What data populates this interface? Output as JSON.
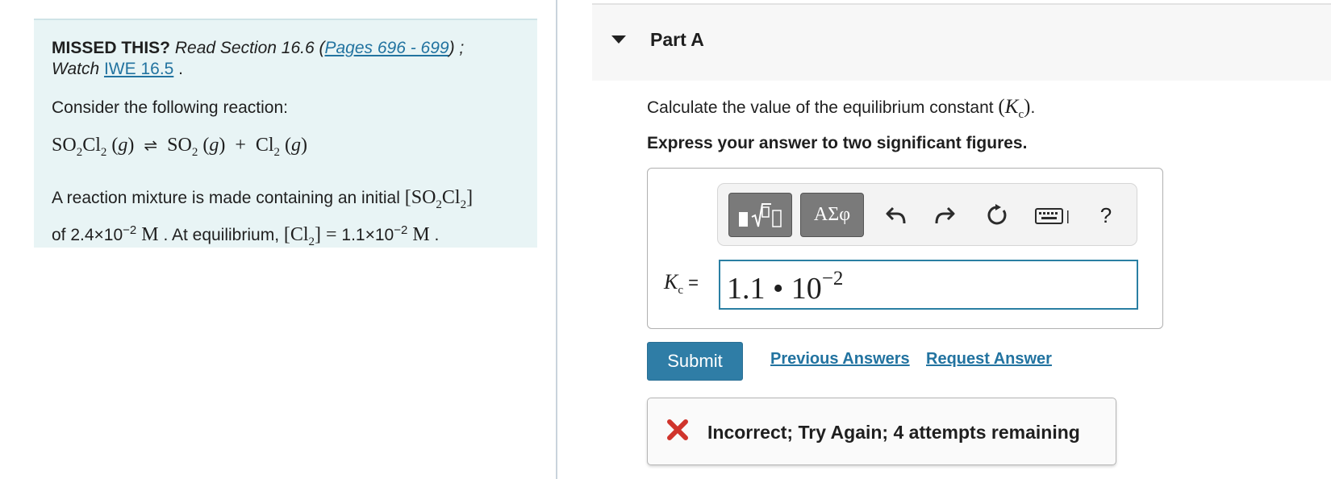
{
  "left": {
    "missed_bold": "MISSED THIS?",
    "missed_text": " Read Section 16.6 (",
    "pages_link": "Pages 696 - 699",
    "missed_text2": ") ;",
    "watch_text": "Watch ",
    "iwe_link": "IWE 16.5",
    "watch_end": " .",
    "intro": "Consider the following reaction:",
    "mix_text1": "A reaction mixture is made containing an initial ",
    "mix_text2": "of 2.4×10",
    "mix_exp1": "−2",
    "mix_text3": " . At equilibrium, ",
    "mix_text4": " 1.1×10",
    "mix_exp2": "−2",
    "mix_text5": " ."
  },
  "part": {
    "title": "Part A",
    "instruction": "Calculate the value of the equilibrium constant ",
    "sig_figs": "Express your answer to two significant figures."
  },
  "toolbar": {
    "greek_label": "ΑΣφ",
    "help_label": "?",
    "icons": [
      "template-icon",
      "undo-icon",
      "redo-icon",
      "reset-icon",
      "keyboard-icon"
    ]
  },
  "answer": {
    "label": "=",
    "mantissa": "1.1 • 10",
    "exponent": "−2"
  },
  "actions": {
    "submit": "Submit",
    "previous": "Previous Answers",
    "request": "Request Answer"
  },
  "feedback": {
    "message": "Incorrect; Try Again; 4 attempts remaining",
    "status_color": "#d0342c"
  }
}
